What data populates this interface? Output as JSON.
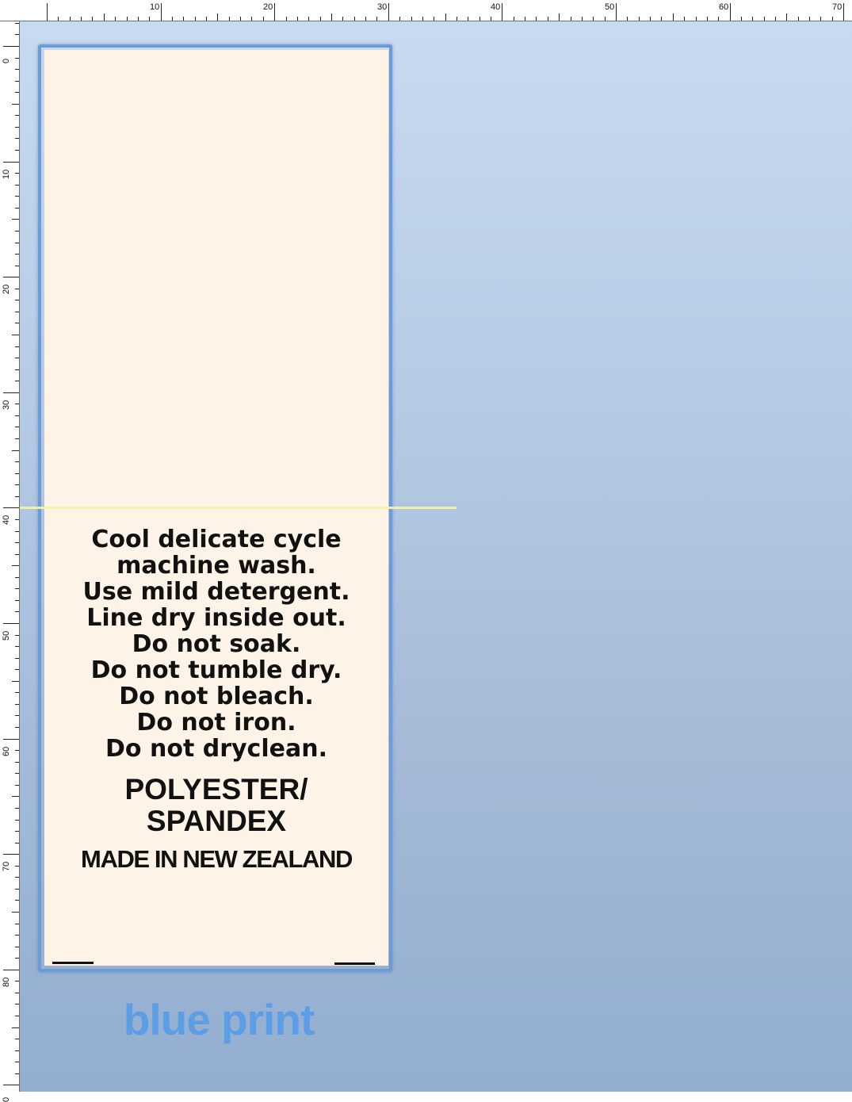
{
  "rulers": {
    "top_labels": [
      "10",
      "20",
      "30",
      "40",
      "50",
      "60",
      "70"
    ],
    "left_labels": [
      "0",
      "10",
      "20",
      "30",
      "40",
      "50",
      "60",
      "70",
      "80",
      "0"
    ]
  },
  "label": {
    "care_lines": [
      "Cool delicate cycle",
      "machine wash.",
      "Use mild detergent.",
      "Line dry inside out.",
      "Do not soak.",
      "Do not tumble dry.",
      "Do not bleach.",
      "Do not iron.",
      "Do not dryclean."
    ],
    "fabric_lines": [
      "POLYESTER/",
      "SPANDEX"
    ],
    "origin": "MADE IN NEW ZEALAND"
  },
  "watermark": "blue print",
  "colors": {
    "label_background": "#fdf3e6",
    "label_border": "#6d9bd3",
    "fold_line": "#f4f2a4",
    "watermark": "#5b9ee6",
    "canvas_top": "#c8daf0",
    "canvas_bottom": "#93aed0"
  }
}
